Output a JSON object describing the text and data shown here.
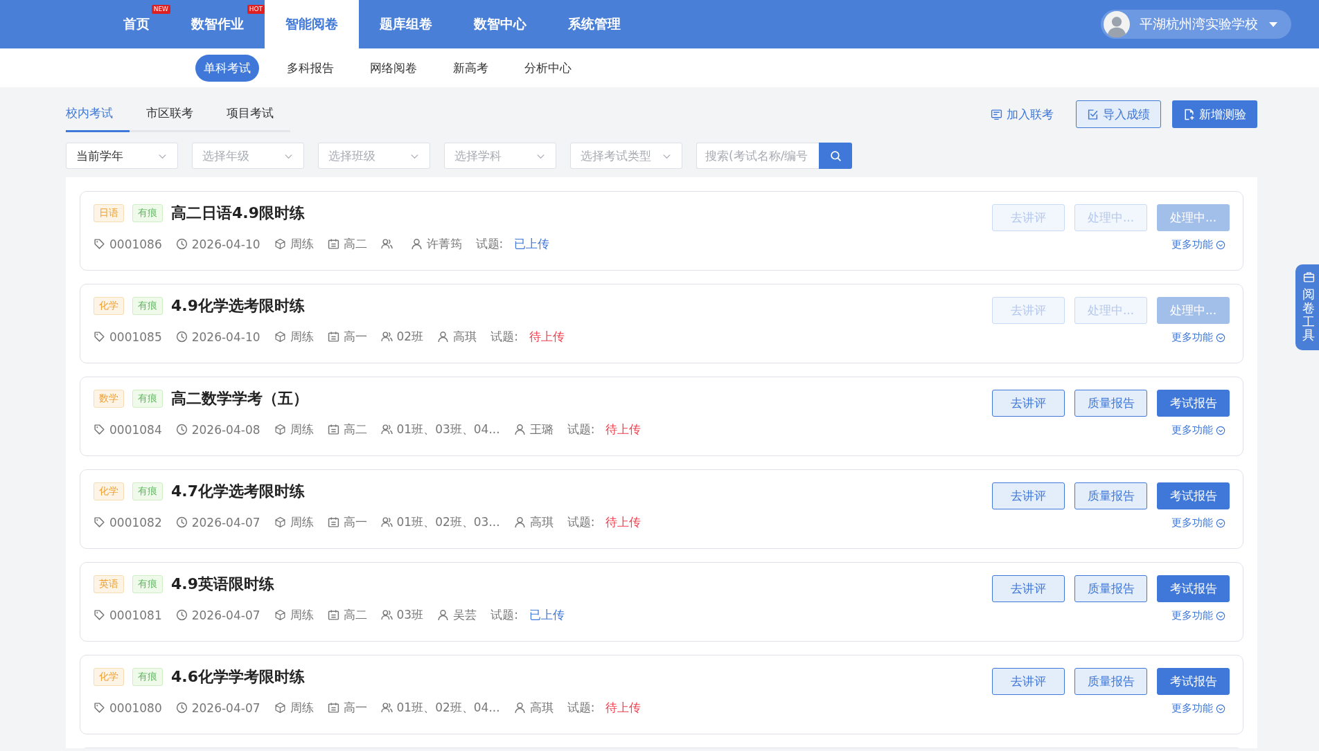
{
  "nav": {
    "items": [
      {
        "label": "首页",
        "selected": false,
        "badge": "NEW"
      },
      {
        "label": "数智作业",
        "selected": false,
        "badge": "HOT"
      },
      {
        "label": "智能阅卷",
        "selected": true
      },
      {
        "label": "题库组卷",
        "selected": false
      },
      {
        "label": "数智中心",
        "selected": false
      },
      {
        "label": "系统管理",
        "selected": false
      }
    ],
    "user": {
      "name": "平湖杭州湾实验学校"
    }
  },
  "subnav": [
    {
      "label": "单科考试",
      "selected": true
    },
    {
      "label": "多科报告",
      "selected": false
    },
    {
      "label": "网络阅卷",
      "selected": false
    },
    {
      "label": "新高考",
      "selected": false
    },
    {
      "label": "分析中心",
      "selected": false
    }
  ],
  "tabs": [
    {
      "label": "校内考试",
      "selected": true
    },
    {
      "label": "市区联考",
      "selected": false
    },
    {
      "label": "项目考试",
      "selected": false
    }
  ],
  "actions": [
    {
      "kind": "link",
      "label": "加入联考"
    },
    {
      "kind": "outline",
      "label": "导入成绩"
    },
    {
      "kind": "primary",
      "label": "新增测验"
    }
  ],
  "filters": [
    {
      "value": "当前学年"
    },
    {
      "placeholder": "选择年级"
    },
    {
      "placeholder": "选择班级"
    },
    {
      "placeholder": "选择学科"
    },
    {
      "placeholder": "选择考试类型"
    }
  ],
  "search": {
    "placeholder": "搜索(考试名称/编号"
  },
  "exams": [
    {
      "subject": "日语",
      "mark": "有痕",
      "title": "高二日语4.9限时练",
      "code": "0001086",
      "date": "2026-04-10",
      "type": "周练",
      "grade": "高二",
      "teacher": "许菁筠",
      "paper_label": "试题:",
      "paper_status": "已上传",
      "uploaded": true,
      "buttons": [
        {
          "label": "去讲评",
          "kind": "outline",
          "disabled": true
        },
        {
          "label": "处理中...",
          "kind": "outline",
          "disabled": true
        },
        {
          "label": "处理中...",
          "kind": "primary",
          "disabled": true
        }
      ],
      "more": "更多功能"
    },
    {
      "subject": "化学",
      "mark": "有痕",
      "title": "4.9化学选考限时练",
      "code": "0001085",
      "date": "2026-04-10",
      "type": "周练",
      "grade": "高一",
      "classes": "02班",
      "teacher": "高琪",
      "paper_label": "试题:",
      "paper_status": "待上传",
      "uploaded": false,
      "buttons": [
        {
          "label": "去讲评",
          "kind": "outline",
          "disabled": true
        },
        {
          "label": "处理中...",
          "kind": "outline",
          "disabled": true
        },
        {
          "label": "处理中...",
          "kind": "primary",
          "disabled": true
        }
      ],
      "more": "更多功能"
    },
    {
      "subject": "数学",
      "mark": "有痕",
      "title": "高二数学学考（五）",
      "code": "0001084",
      "date": "2026-04-08",
      "type": "周练",
      "grade": "高二",
      "classes": "01班、03班、04...",
      "teacher": "王璐",
      "paper_label": "试题:",
      "paper_status": "待上传",
      "uploaded": false,
      "buttons": [
        {
          "label": "去讲评",
          "kind": "outline",
          "disabled": false
        },
        {
          "label": "质量报告",
          "kind": "outline",
          "disabled": false
        },
        {
          "label": "考试报告",
          "kind": "primary",
          "disabled": false
        }
      ],
      "more": "更多功能"
    },
    {
      "subject": "化学",
      "mark": "有痕",
      "title": "4.7化学选考限时练",
      "code": "0001082",
      "date": "2026-04-07",
      "type": "周练",
      "grade": "高一",
      "classes": "01班、02班、03...",
      "teacher": "高琪",
      "paper_label": "试题:",
      "paper_status": "待上传",
      "uploaded": false,
      "buttons": [
        {
          "label": "去讲评",
          "kind": "outline",
          "disabled": false
        },
        {
          "label": "质量报告",
          "kind": "outline",
          "disabled": false
        },
        {
          "label": "考试报告",
          "kind": "primary",
          "disabled": false
        }
      ],
      "more": "更多功能"
    },
    {
      "subject": "英语",
      "mark": "有痕",
      "title": "4.9英语限时练",
      "code": "0001081",
      "date": "2026-04-07",
      "type": "周练",
      "grade": "高二",
      "classes": "03班",
      "teacher": "吴芸",
      "paper_label": "试题:",
      "paper_status": "已上传",
      "uploaded": true,
      "buttons": [
        {
          "label": "去讲评",
          "kind": "outline",
          "disabled": false
        },
        {
          "label": "质量报告",
          "kind": "outline",
          "disabled": false
        },
        {
          "label": "考试报告",
          "kind": "primary",
          "disabled": false
        }
      ],
      "more": "更多功能"
    },
    {
      "subject": "化学",
      "mark": "有痕",
      "title": "4.6化学学考限时练",
      "code": "0001080",
      "date": "2026-04-07",
      "type": "周练",
      "grade": "高一",
      "classes": "01班、02班、04...",
      "teacher": "高琪",
      "paper_label": "试题:",
      "paper_status": "待上传",
      "uploaded": false,
      "buttons": [
        {
          "label": "去讲评",
          "kind": "outline",
          "disabled": false
        },
        {
          "label": "质量报告",
          "kind": "outline",
          "disabled": false
        },
        {
          "label": "考试报告",
          "kind": "primary",
          "disabled": false
        }
      ],
      "more": "更多功能"
    }
  ],
  "side_tool": {
    "label": "阅卷工具"
  }
}
